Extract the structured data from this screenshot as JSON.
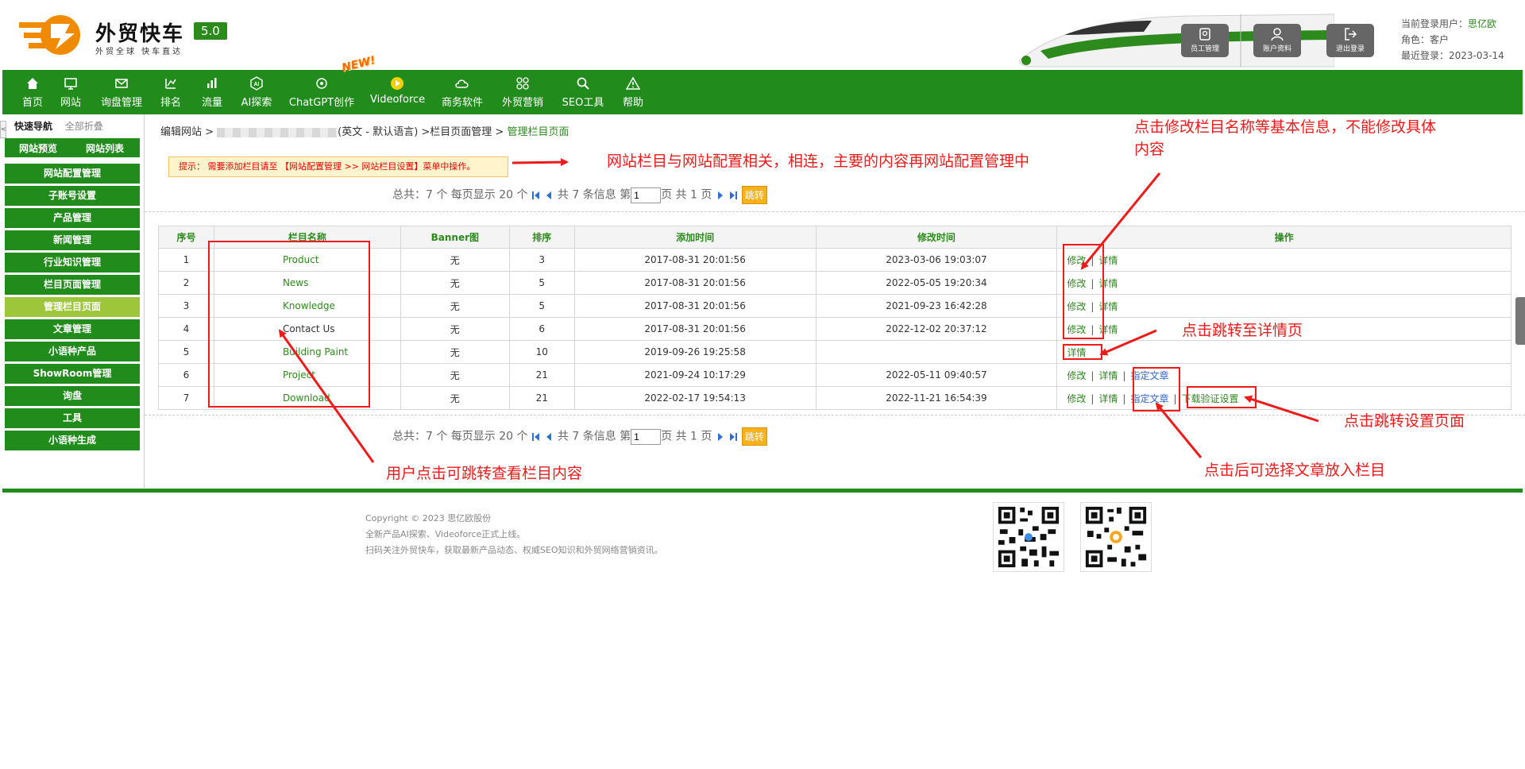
{
  "header": {
    "logo_title": "外贸快车",
    "logo_sub": "外贸全球 快车直达",
    "version": "5.0",
    "buttons": [
      {
        "label": "员工管理",
        "icon": "staff-icon"
      },
      {
        "label": "账户资料",
        "icon": "account-icon"
      },
      {
        "label": "退出登录",
        "icon": "logout-icon"
      }
    ],
    "user_label": "当前登录用户：",
    "user_name": "思亿欧",
    "role": "角色：客户",
    "last_login": "最近登录：2023-03-14"
  },
  "nav": {
    "items": [
      {
        "label": "首页",
        "icon": "home-icon"
      },
      {
        "label": "网站",
        "icon": "monitor-icon"
      },
      {
        "label": "询盘管理",
        "icon": "mail-icon"
      },
      {
        "label": "排名",
        "icon": "ranking-icon"
      },
      {
        "label": "流量",
        "icon": "bar-chart-icon"
      },
      {
        "label": "AI探索",
        "icon": "ai-icon"
      },
      {
        "label": "ChatGPT创作",
        "icon": "chatgpt-icon"
      },
      {
        "label": "Videoforce",
        "icon": "video-icon"
      },
      {
        "label": "商务软件",
        "icon": "cloud-icon"
      },
      {
        "label": "外贸营销",
        "icon": "apps-icon"
      },
      {
        "label": "SEO工具",
        "icon": "search-icon"
      },
      {
        "label": "帮助",
        "icon": "warning-icon"
      }
    ],
    "new_badge": "NEW!"
  },
  "sidebar": {
    "quick_nav": "快速导航",
    "collapse_all": "全部折叠",
    "handle": "<",
    "top_left": "网站预览",
    "top_right": "网站列表",
    "items": [
      {
        "label": "网站配置管理"
      },
      {
        "label": "子账号设置"
      },
      {
        "label": "产品管理"
      },
      {
        "label": "新闻管理"
      },
      {
        "label": "行业知识管理"
      },
      {
        "label": "栏目页面管理"
      },
      {
        "label": "管理栏目页面"
      },
      {
        "label": "文章管理"
      },
      {
        "label": "小语种产品"
      },
      {
        "label": "ShowRoom管理"
      },
      {
        "label": "询盘"
      },
      {
        "label": "工具"
      },
      {
        "label": "小语种生成"
      }
    ],
    "active_index": 6
  },
  "breadcrumb": {
    "p1": "编辑网站 >",
    "p2": "(英文 - 默认语言) >栏目页面管理 >",
    "current": "管理栏目页面"
  },
  "tip": "提示：  需要添加栏目请至 【网站配置管理 >> 网站栏目设置】菜单中操作。",
  "pager": {
    "text1": "总共：7 个 每页显示 20 个",
    "text2": "共 7 条信息 第",
    "page_value": "1",
    "text3": "页 共 1 页",
    "go": "跳转"
  },
  "table": {
    "headers": [
      "序号",
      "栏目名称",
      "Banner图",
      "排序",
      "添加时间",
      "修改时间",
      "操作"
    ],
    "rows": [
      {
        "no": "1",
        "name": "Product",
        "banner": "无",
        "sort": "3",
        "added": "2017-08-31 20:01:56",
        "modified": "2023-03-06 19:03:07",
        "ops": [
          "修改",
          "详情"
        ]
      },
      {
        "no": "2",
        "name": "News",
        "banner": "无",
        "sort": "5",
        "added": "2017-08-31 20:01:56",
        "modified": "2022-05-05 19:20:34",
        "ops": [
          "修改",
          "详情"
        ]
      },
      {
        "no": "3",
        "name": "Knowledge",
        "banner": "无",
        "sort": "5",
        "added": "2017-08-31 20:01:56",
        "modified": "2021-09-23 16:42:28",
        "ops": [
          "修改",
          "详情"
        ]
      },
      {
        "no": "4",
        "name": "Contact Us",
        "banner": "无",
        "sort": "6",
        "added": "2017-08-31 20:01:56",
        "modified": "2022-12-02 20:37:12",
        "ops": [
          "修改",
          "详情"
        ]
      },
      {
        "no": "5",
        "name": "Building Paint",
        "banner": "无",
        "sort": "10",
        "added": "2019-09-26 19:25:58",
        "modified": "",
        "ops": [
          "详情"
        ]
      },
      {
        "no": "6",
        "name": "Project",
        "banner": "无",
        "sort": "21",
        "added": "2021-09-24 10:17:29",
        "modified": "2022-05-11 09:40:57",
        "ops": [
          "修改",
          "详情",
          "指定文章"
        ]
      },
      {
        "no": "7",
        "name": "Download",
        "banner": "无",
        "sort": "21",
        "added": "2022-02-17 19:54:13",
        "modified": "2022-11-21 16:54:39",
        "ops": [
          "修改",
          "详情",
          "指定文章",
          "下载验证设置"
        ]
      }
    ]
  },
  "footer": {
    "copyright": "Copyright © 2023 思亿欧股份",
    "line2": "全新产品AI探索、Videoforce正式上线。",
    "line3": "扫码关注外贸快车，获取最新产品动态、权威SEO知识和外贸网络营销资讯。"
  },
  "annotations": {
    "config_note": "网站栏目与网站配置相关，相连，主要的内容再网站配置管理中",
    "edit_note_1": "点击修改栏目名称等基本信息，不能修改具体",
    "edit_note_2": "内容",
    "detail_note": "点击跳转至详情页",
    "setting_note": "点击跳转设置页面",
    "article_note": "点击后可选择文章放入栏目",
    "name_note": "用户点击可跳转查看栏目内容"
  },
  "colors": {
    "brand_green": "#218c1c",
    "active_green": "#9dc63b",
    "annotation_red": "#ee1b1b",
    "logo_orange": "#f08a00"
  }
}
